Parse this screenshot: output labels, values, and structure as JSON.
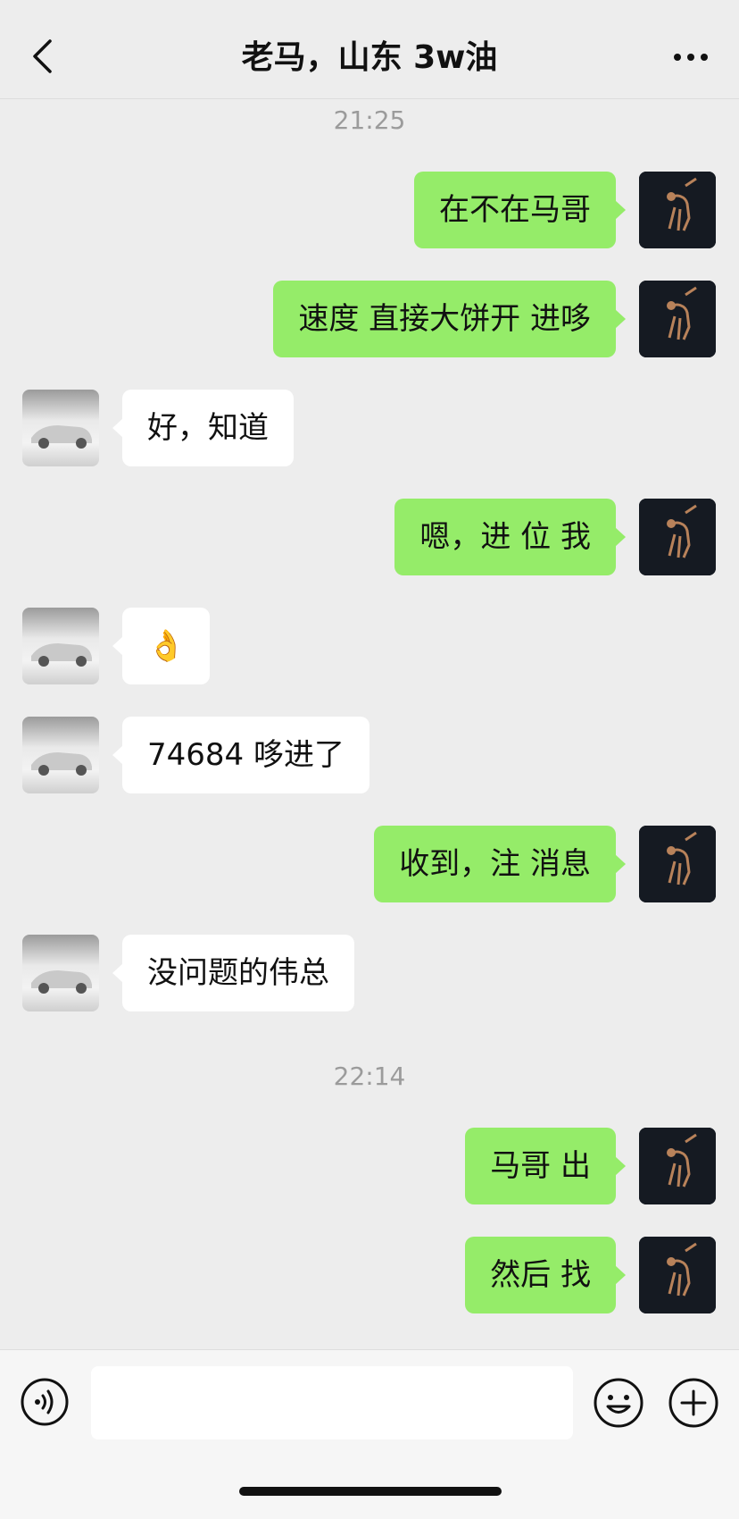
{
  "header": {
    "title": "老马，山东 3w油",
    "back_icon": "chevron-left-icon",
    "more_icon": "more-dots-icon"
  },
  "timestamps": [
    "21:25",
    "22:14"
  ],
  "messages": [
    {
      "side": "right",
      "text": "在不在马哥"
    },
    {
      "side": "right",
      "text": "速度 直接大饼开 进哆"
    },
    {
      "side": "left",
      "text": "好，知道"
    },
    {
      "side": "right",
      "text": "嗯，进 位 我"
    },
    {
      "side": "left",
      "text": "👌"
    },
    {
      "side": "left",
      "text": "74684 哆进了"
    },
    {
      "side": "right",
      "text": "收到，注 消息"
    },
    {
      "side": "left",
      "text": "没问题的伟总"
    },
    {
      "side": "right",
      "text": "马哥 出"
    },
    {
      "side": "right",
      "text": "然后 找"
    }
  ],
  "input": {
    "placeholder": "",
    "voice_icon": "voice-icon",
    "emoji_icon": "emoji-icon",
    "plus_icon": "plus-icon"
  },
  "colors": {
    "background": "#ededed",
    "sent_bubble": "#95ec69",
    "received_bubble": "#ffffff",
    "timestamp": "#9b9b9b"
  }
}
